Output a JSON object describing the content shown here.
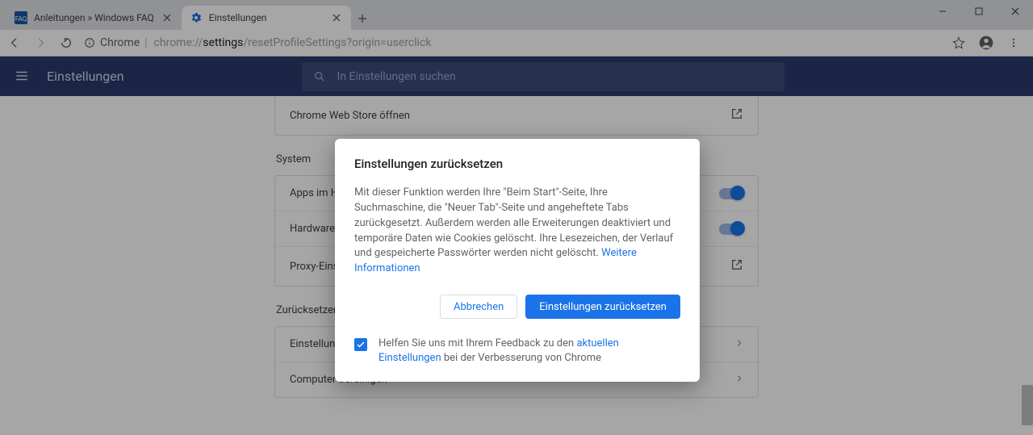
{
  "window": {
    "tabs": [
      {
        "title": "Anleitungen » Windows FAQ",
        "active": false
      },
      {
        "title": "Einstellungen",
        "active": true
      }
    ]
  },
  "omnibox": {
    "scheme_label": "Chrome",
    "url_prefix": "chrome://",
    "url_bold": "settings",
    "url_rest": "/resetProfileSettings?origin=userclick"
  },
  "header": {
    "title": "Einstellungen",
    "search_placeholder": "In Einstellungen suchen"
  },
  "page": {
    "webstore_row": "Chrome Web Store öffnen",
    "section_system": "System",
    "row_apps": "Apps im Hintergrund ausführen, wenn Google Chrome geschlossen ist",
    "row_hw": "Hardwarebeschleunigung verwenden, falls verfügbar",
    "row_proxy": "Proxy-Einstellungen des Computers öffnen",
    "section_reset": "Zurücksetzen und bereinigen",
    "row_reset": "Einstellungen auf ursprüngliche Standardwerte zurücksetzen",
    "row_cleanup": "Computer bereinigen"
  },
  "dialog": {
    "title": "Einstellungen zurücksetzen",
    "body": "Mit dieser Funktion werden Ihre \"Beim Start\"-Seite, Ihre Suchmaschine, die \"Neuer Tab\"-Seite und angeheftete Tabs zurückgesetzt. Außerdem werden alle Erweiterungen deaktiviert und temporäre Daten wie Cookies gelöscht. Ihre Lesezeichen, der Verlauf und gespeicherte Passwörter werden nicht gelöscht.",
    "learn_more": "Weitere Informationen",
    "cancel": "Abbrechen",
    "confirm": "Einstellungen zurücksetzen",
    "feedback_pre": "Helfen Sie uns mit Ihrem Feedback zu den ",
    "feedback_link": "aktuellen Einstellungen",
    "feedback_post": " bei der Verbesserung von Chrome",
    "feedback_checked": true
  }
}
